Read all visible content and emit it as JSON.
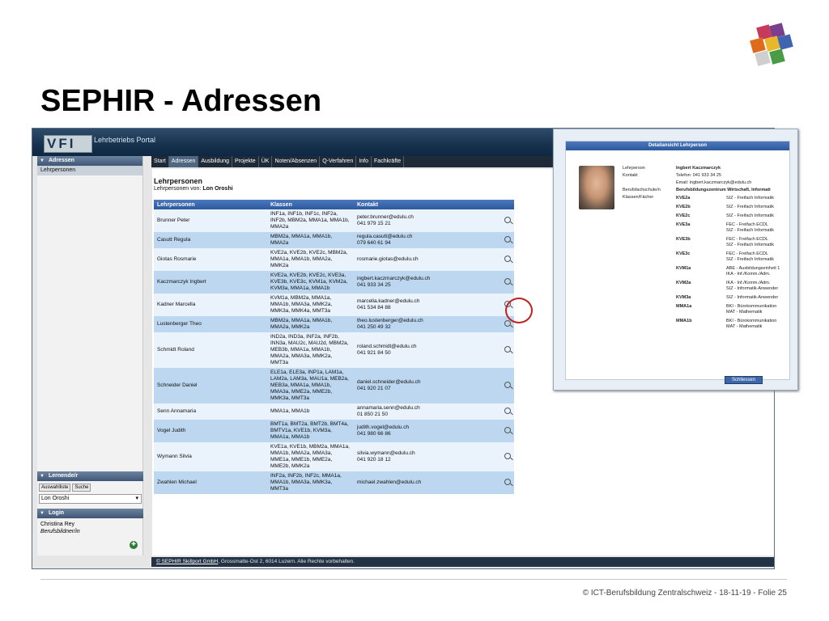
{
  "slide": {
    "title": "SEPHIR - Adressen",
    "credit": "© ICT-Berufsbildung Zentralschweiz - 18-11-19 - Folie 25",
    "logo_colors": [
      "#c63b5a",
      "#7a3e8f",
      "#e06a1c",
      "#4a9c44",
      "#3f64b0",
      "#e8b72b"
    ]
  },
  "app": {
    "brand": "VFI",
    "portal_title": "Lehrbetriebs Portal",
    "nav": [
      "Start",
      "Adressen",
      "Ausbildung",
      "Projekte",
      "ÜK",
      "Noten/Absenzen",
      "Q-Verfahren",
      "Info",
      "Fachkräfte"
    ],
    "nav_active": "Adressen",
    "sidebar": {
      "adressen_head": "Adressen",
      "adressen_item": "Lehrpersonen",
      "lernende_head": "Lernende/r",
      "tab_auswahl": "Auswahlliste",
      "tab_suche": "Suche",
      "select_value": "Lon Oroshi",
      "login_head": "Login",
      "user_name": "Christina Rey",
      "user_role": "Berufsbildner/in"
    },
    "content": {
      "title": "Lehrpersonen",
      "subtitle_prefix": "Lehrpersonen von:",
      "subtitle_name": "Lon Oroshi",
      "columns": [
        "Lehrpersonen",
        "Klassen",
        "Kontakt"
      ],
      "rows": [
        {
          "name": "Brunner Peter",
          "classes": "INF1a, INF1b, INF1c, INF2a, INF2b, MBM2a, MMA1a, MMA1b, MMA2a",
          "email": "peter.brunner@edulu.ch",
          "phone": "041 979 15 21"
        },
        {
          "name": "Casutt Regula",
          "classes": "MBM2a, MMA1a, MMA1b, MMA2a",
          "email": "regula.casutt@edulu.ch",
          "phone": "079 640 61 94"
        },
        {
          "name": "Giotas Rosmarie",
          "classes": "KVE2a, KVE2b, KVE2c, MBM2a, MMA1a, MMA1b, MMA2a, MMK2a",
          "email": "rosmarie.giotas@edulu.ch",
          "phone": ""
        },
        {
          "name": "Kaczmarczyk Ingbert",
          "classes": "KVE2a, KVE2b, KVE2c, KVE3a, KVE3b, KVE3c, KVM1a, KVM2a, KVM3a, MMA1a, MMA1b",
          "email": "ingbert.kaczmarczyk@edulu.ch",
          "phone": "041 933 34 25"
        },
        {
          "name": "Kadner Marcella",
          "classes": "KVM1a, MBM2a, MMA1a, MMA1b, MMA3a, MMK2a, MMK3a, MMK4a, MMT3a",
          "email": "marcella.kadner@edulu.ch",
          "phone": "041 534 84 88"
        },
        {
          "name": "Lustenberger Theo",
          "classes": "MBM2a, MMA1a, MMA1b, MMA2a, MMK2a",
          "email": "theo.lustenberger@edulu.ch",
          "phone": "041 250 49 32"
        },
        {
          "name": "Schmidt Roland",
          "classes": "IND2a, IND3a, INF2a, INF2b, INN3a, MAU2c, MAU2d, MBM2a, MEB3b, MMA1a, MMA1b, MMA2a, MMA3a, MMK2a, MMT3a",
          "email": "roland.schmidt@edulu.ch",
          "phone": "041 921 84 50"
        },
        {
          "name": "Schneider Daniel",
          "classes": "ELE1a, ELE3a, INP1a, LAM1a, LAM2a, LAM3a, MAU1a, MEB2a, MEB3a, MMA1a, MMA1b, MMA3a, MME2a, MME2b, MMK3a, MMT3a",
          "email": "daniel.schneider@edulu.ch",
          "phone": "041 920 21 07"
        },
        {
          "name": "Senn Annamaria",
          "classes": "MMA1a, MMA1b",
          "email": "annamaria.senn@edulu.ch",
          "phone": "01 850 21 50"
        },
        {
          "name": "Vogel Judith",
          "classes": "BMT1a, BMT2a, BMT2b, BMT4a, BMTV1a, KVE1b, KVM3a, MMA1a, MMA1b",
          "email": "judith.vogel@edulu.ch",
          "phone": "041 980 66 86"
        },
        {
          "name": "Wymann Silvia",
          "classes": "KVE1a, KVE1b, MBM2a, MMA1a, MMA1b, MMA2a, MMA3a, MME1a, MME1b, MME2a, MME2b, MMK2a",
          "email": "silvia.wymann@edulu.ch",
          "phone": "041 920 18 12"
        },
        {
          "name": "Zwahlen Michael",
          "classes": "INF2a, INF2b, INF2c, MMA1a, MMA1b, MMA3a, MMK3a, MMT3a",
          "email": "michael.zwahlen@edulu.ch",
          "phone": ""
        }
      ]
    },
    "footer": {
      "company": "© SEPHIR Skillport GmbH",
      "rest": ", Grossmatte-Ost 2, 6014 Luzern. Alle Rechte vorbehalten."
    }
  },
  "popup": {
    "title": "Detailansicht Lehrperson",
    "fields": [
      {
        "label": "Lehrperson",
        "value": "Ingbert Kaczmarczyk",
        "bold": true
      },
      {
        "label": "Kontakt",
        "value": "Telefon: 041 933 34 25",
        "bold": false
      },
      {
        "label": "",
        "value": "Email: ingbert.kaczmarczyk@edulu.ch",
        "bold": false
      },
      {
        "label": "Berufsfachschule/n",
        "value": "Berufsbildungszentrum Wirtschaft, Informati",
        "bold": true
      },
      {
        "label": "Klassen/Fächer",
        "value": "",
        "bold": false
      }
    ],
    "classes": [
      {
        "cls": "KVE2a",
        "subj": "SIZ - Freifach Informatik"
      },
      {
        "cls": "KVE2b",
        "subj": "SIZ - Freifach Informatik"
      },
      {
        "cls": "KVE2c",
        "subj": "SIZ - Freifach Informatik"
      },
      {
        "cls": "KVE3a",
        "subj": "FEC - Freifach ECDL / SIZ - Freifach Informatik"
      },
      {
        "cls": "KVE3b",
        "subj": "FEC - Freifach ECDL / SIZ - Freifach Informatik"
      },
      {
        "cls": "KVE3c",
        "subj": "FEC - Freifach ECDL / SIZ - Freifach Informatik"
      },
      {
        "cls": "KVM1a",
        "subj": "ABE - Ausbildungseinheit 1 / IKA - Inf./Komm./Adm."
      },
      {
        "cls": "KVM2a",
        "subj": "IKA - Inf./Komm./Adm. / SIZ - Informatik-Anwender"
      },
      {
        "cls": "KVM3a",
        "subj": "SIZ - Informatik-Anwender"
      },
      {
        "cls": "MMA1a",
        "subj": "BKI - Bürokommunikation / MAT - Mathematik"
      },
      {
        "cls": "MMA1b",
        "subj": "BKI - Bürokommunikation / MAT - Mathematik"
      }
    ],
    "close_label": "Schliessen"
  }
}
